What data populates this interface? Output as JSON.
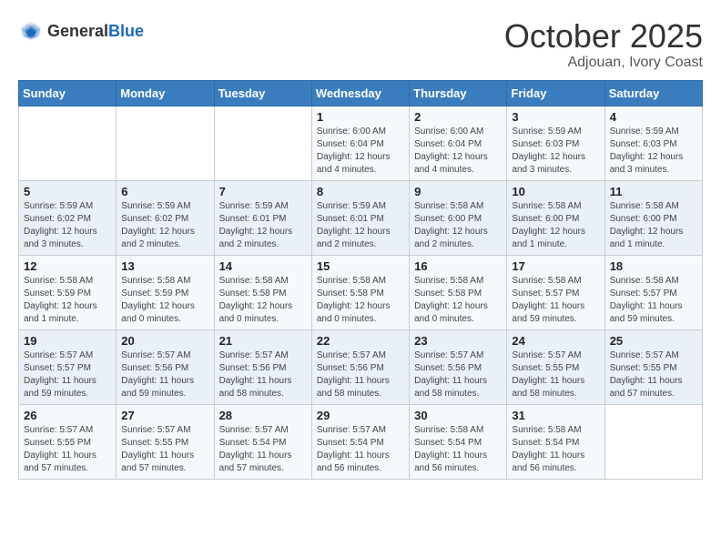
{
  "logo": {
    "general": "General",
    "blue": "Blue"
  },
  "title": "October 2025",
  "subtitle": "Adjouan, Ivory Coast",
  "headers": [
    "Sunday",
    "Monday",
    "Tuesday",
    "Wednesday",
    "Thursday",
    "Friday",
    "Saturday"
  ],
  "weeks": [
    [
      {
        "day": "",
        "info": ""
      },
      {
        "day": "",
        "info": ""
      },
      {
        "day": "",
        "info": ""
      },
      {
        "day": "1",
        "info": "Sunrise: 6:00 AM\nSunset: 6:04 PM\nDaylight: 12 hours\nand 4 minutes."
      },
      {
        "day": "2",
        "info": "Sunrise: 6:00 AM\nSunset: 6:04 PM\nDaylight: 12 hours\nand 4 minutes."
      },
      {
        "day": "3",
        "info": "Sunrise: 5:59 AM\nSunset: 6:03 PM\nDaylight: 12 hours\nand 3 minutes."
      },
      {
        "day": "4",
        "info": "Sunrise: 5:59 AM\nSunset: 6:03 PM\nDaylight: 12 hours\nand 3 minutes."
      }
    ],
    [
      {
        "day": "5",
        "info": "Sunrise: 5:59 AM\nSunset: 6:02 PM\nDaylight: 12 hours\nand 3 minutes."
      },
      {
        "day": "6",
        "info": "Sunrise: 5:59 AM\nSunset: 6:02 PM\nDaylight: 12 hours\nand 2 minutes."
      },
      {
        "day": "7",
        "info": "Sunrise: 5:59 AM\nSunset: 6:01 PM\nDaylight: 12 hours\nand 2 minutes."
      },
      {
        "day": "8",
        "info": "Sunrise: 5:59 AM\nSunset: 6:01 PM\nDaylight: 12 hours\nand 2 minutes."
      },
      {
        "day": "9",
        "info": "Sunrise: 5:58 AM\nSunset: 6:00 PM\nDaylight: 12 hours\nand 2 minutes."
      },
      {
        "day": "10",
        "info": "Sunrise: 5:58 AM\nSunset: 6:00 PM\nDaylight: 12 hours\nand 1 minute."
      },
      {
        "day": "11",
        "info": "Sunrise: 5:58 AM\nSunset: 6:00 PM\nDaylight: 12 hours\nand 1 minute."
      }
    ],
    [
      {
        "day": "12",
        "info": "Sunrise: 5:58 AM\nSunset: 5:59 PM\nDaylight: 12 hours\nand 1 minute."
      },
      {
        "day": "13",
        "info": "Sunrise: 5:58 AM\nSunset: 5:59 PM\nDaylight: 12 hours\nand 0 minutes."
      },
      {
        "day": "14",
        "info": "Sunrise: 5:58 AM\nSunset: 5:58 PM\nDaylight: 12 hours\nand 0 minutes."
      },
      {
        "day": "15",
        "info": "Sunrise: 5:58 AM\nSunset: 5:58 PM\nDaylight: 12 hours\nand 0 minutes."
      },
      {
        "day": "16",
        "info": "Sunrise: 5:58 AM\nSunset: 5:58 PM\nDaylight: 12 hours\nand 0 minutes."
      },
      {
        "day": "17",
        "info": "Sunrise: 5:58 AM\nSunset: 5:57 PM\nDaylight: 11 hours\nand 59 minutes."
      },
      {
        "day": "18",
        "info": "Sunrise: 5:58 AM\nSunset: 5:57 PM\nDaylight: 11 hours\nand 59 minutes."
      }
    ],
    [
      {
        "day": "19",
        "info": "Sunrise: 5:57 AM\nSunset: 5:57 PM\nDaylight: 11 hours\nand 59 minutes."
      },
      {
        "day": "20",
        "info": "Sunrise: 5:57 AM\nSunset: 5:56 PM\nDaylight: 11 hours\nand 59 minutes."
      },
      {
        "day": "21",
        "info": "Sunrise: 5:57 AM\nSunset: 5:56 PM\nDaylight: 11 hours\nand 58 minutes."
      },
      {
        "day": "22",
        "info": "Sunrise: 5:57 AM\nSunset: 5:56 PM\nDaylight: 11 hours\nand 58 minutes."
      },
      {
        "day": "23",
        "info": "Sunrise: 5:57 AM\nSunset: 5:56 PM\nDaylight: 11 hours\nand 58 minutes."
      },
      {
        "day": "24",
        "info": "Sunrise: 5:57 AM\nSunset: 5:55 PM\nDaylight: 11 hours\nand 58 minutes."
      },
      {
        "day": "25",
        "info": "Sunrise: 5:57 AM\nSunset: 5:55 PM\nDaylight: 11 hours\nand 57 minutes."
      }
    ],
    [
      {
        "day": "26",
        "info": "Sunrise: 5:57 AM\nSunset: 5:55 PM\nDaylight: 11 hours\nand 57 minutes."
      },
      {
        "day": "27",
        "info": "Sunrise: 5:57 AM\nSunset: 5:55 PM\nDaylight: 11 hours\nand 57 minutes."
      },
      {
        "day": "28",
        "info": "Sunrise: 5:57 AM\nSunset: 5:54 PM\nDaylight: 11 hours\nand 57 minutes."
      },
      {
        "day": "29",
        "info": "Sunrise: 5:57 AM\nSunset: 5:54 PM\nDaylight: 11 hours\nand 56 minutes."
      },
      {
        "day": "30",
        "info": "Sunrise: 5:58 AM\nSunset: 5:54 PM\nDaylight: 11 hours\nand 56 minutes."
      },
      {
        "day": "31",
        "info": "Sunrise: 5:58 AM\nSunset: 5:54 PM\nDaylight: 11 hours\nand 56 minutes."
      },
      {
        "day": "",
        "info": ""
      }
    ]
  ]
}
